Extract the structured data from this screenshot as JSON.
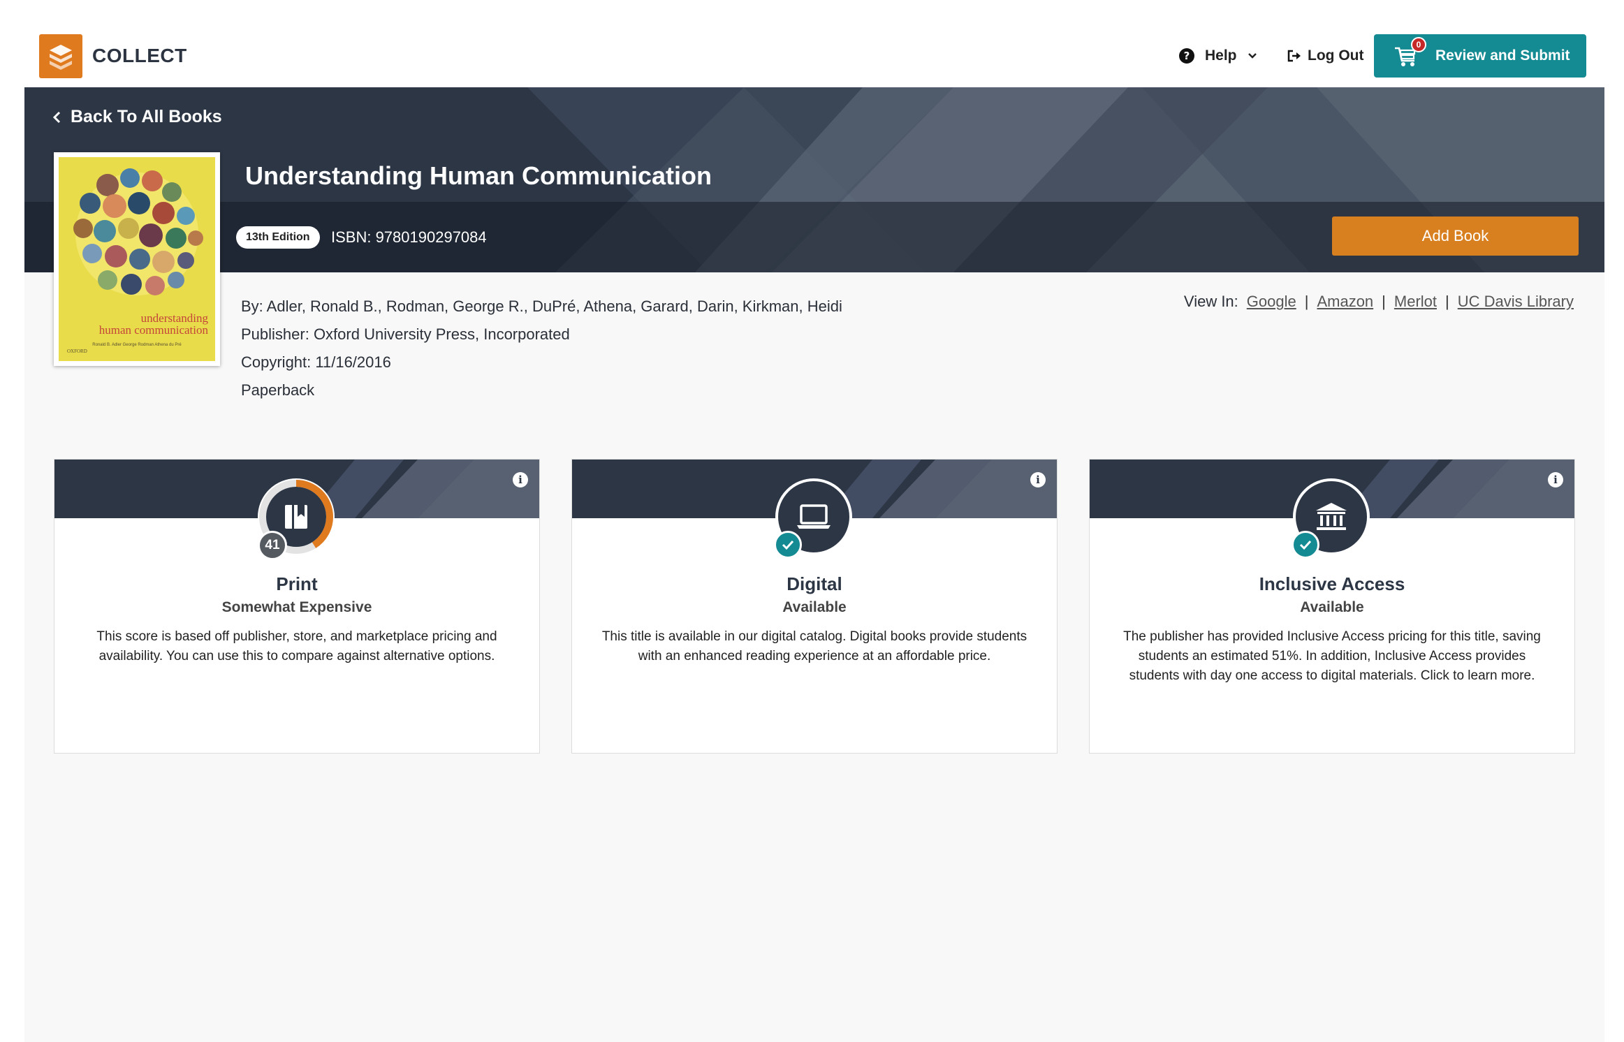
{
  "header": {
    "logo_text": "COLLECT",
    "help_label": "Help",
    "logout_label": "Log Out",
    "review_label": "Review and Submit",
    "cart_count": "0"
  },
  "hero": {
    "back_label": "Back To All Books",
    "title": "Understanding Human Communication",
    "edition": "13th Edition",
    "isbn": "ISBN: 9780190297084",
    "add_book_label": "Add Book"
  },
  "cover": {
    "title_line1": "understanding",
    "title_line2": "human communication",
    "authors": "Ronald B. Adler    George Rodman    Athena du Pré",
    "publisher_mark": "OXFORD"
  },
  "book_meta": {
    "by": "By: Adler, Ronald B., Rodman, George R., DuPré, Athena, Garard, Darin, Kirkman, Heidi",
    "publisher": "Publisher: Oxford University Press, Incorporated",
    "copyright": "Copyright: 11/16/2016",
    "format": "Paperback"
  },
  "view_in": {
    "label": "View In:",
    "links": [
      "Google",
      "Amazon",
      "Merlot",
      "UC Davis Library"
    ],
    "separator": "|"
  },
  "cards": [
    {
      "title": "Print",
      "subtitle": "Somewhat Expensive",
      "score": "41",
      "score_fraction": 0.41,
      "icon": "book-icon",
      "description": "This score is based off publisher, store, and marketplace pricing and availability. You can use this to compare against alternative options."
    },
    {
      "title": "Digital",
      "subtitle": "Available",
      "icon": "laptop-icon",
      "description": "This title is available in our digital catalog. Digital books provide students with an enhanced reading experience at an affordable price."
    },
    {
      "title": "Inclusive Access",
      "subtitle": "Available",
      "icon": "institution-icon",
      "description": "The publisher has provided Inclusive Access pricing for this title, saving students an estimated 51%. In addition, Inclusive Access provides students with day one access to digital materials. Click to learn more."
    }
  ],
  "colors": {
    "brand_orange": "#e07a1f",
    "teal": "#148a93",
    "navy": "#2c3645",
    "add_book": "#d8801f"
  }
}
